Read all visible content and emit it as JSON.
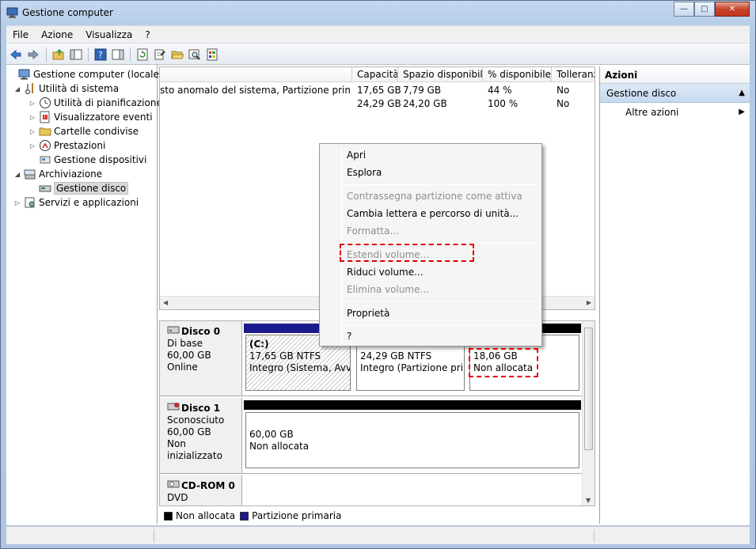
{
  "window": {
    "title": "Gestione computer"
  },
  "menu": [
    "File",
    "Azione",
    "Visualizza",
    "?"
  ],
  "tree": {
    "root": "Gestione computer (locale)",
    "system_tools": "Utilità di sistema",
    "scheduler": "Utilità di pianificazione",
    "event_viewer": "Visualizzatore eventi",
    "shared_folders": "Cartelle condivise",
    "performance": "Prestazioni",
    "device_manager": "Gestione dispositivi",
    "storage": "Archiviazione",
    "disk_management": "Gestione disco",
    "services": "Servizi e applicazioni"
  },
  "volume_list": {
    "columns": [
      "Capacità",
      "Spazio disponibile",
      "% disponibile",
      "Tolleranza"
    ],
    "rows": [
      {
        "status": "sto anomalo del sistema, Partizione primaria)",
        "capacity": "17,65 GB",
        "free": "7,79 GB",
        "pct": "44 %",
        "tolerance": "No"
      },
      {
        "status": "",
        "capacity": "24,29 GB",
        "free": "24,20 GB",
        "pct": "100 %",
        "tolerance": "No"
      }
    ]
  },
  "disks": {
    "disk0": {
      "name": "Disco 0",
      "type": "Di base",
      "size": "60,00 GB",
      "state": "Online",
      "c_label": "(C:)",
      "c_size": "17,65 GB NTFS",
      "c_status": "Integro (Sistema, Avvio,",
      "p2_size": "24,29 GB NTFS",
      "p2_status": "Integro (Partizione prima",
      "un_size": "18,06 GB",
      "un_status": "Non allocata"
    },
    "disk1": {
      "name": "Disco 1",
      "type": "Sconosciuto",
      "size": "60,00 GB",
      "state": "Non inizializzato",
      "un_size": "60,00 GB",
      "un_status": "Non allocata"
    },
    "cdrom": {
      "name": "CD-ROM 0",
      "type": "DVD"
    }
  },
  "legend": {
    "unallocated": "Non allocata",
    "primary": "Partizione primaria"
  },
  "actions": {
    "header": "Azioni",
    "section": "Gestione disco",
    "more": "Altre azioni"
  },
  "context_menu": {
    "open": "Apri",
    "explore": "Esplora",
    "mark_active": "Contrassegna partizione come attiva",
    "change_letter": "Cambia lettera e percorso di unità...",
    "format": "Formatta...",
    "extend": "Estendi volume...",
    "shrink": "Riduci volume...",
    "delete": "Elimina volume...",
    "properties": "Proprietà",
    "help": "?"
  },
  "colors": {
    "primary_partition": "#1a1a8c",
    "unallocated": "#000000",
    "highlight": "#e00000"
  }
}
